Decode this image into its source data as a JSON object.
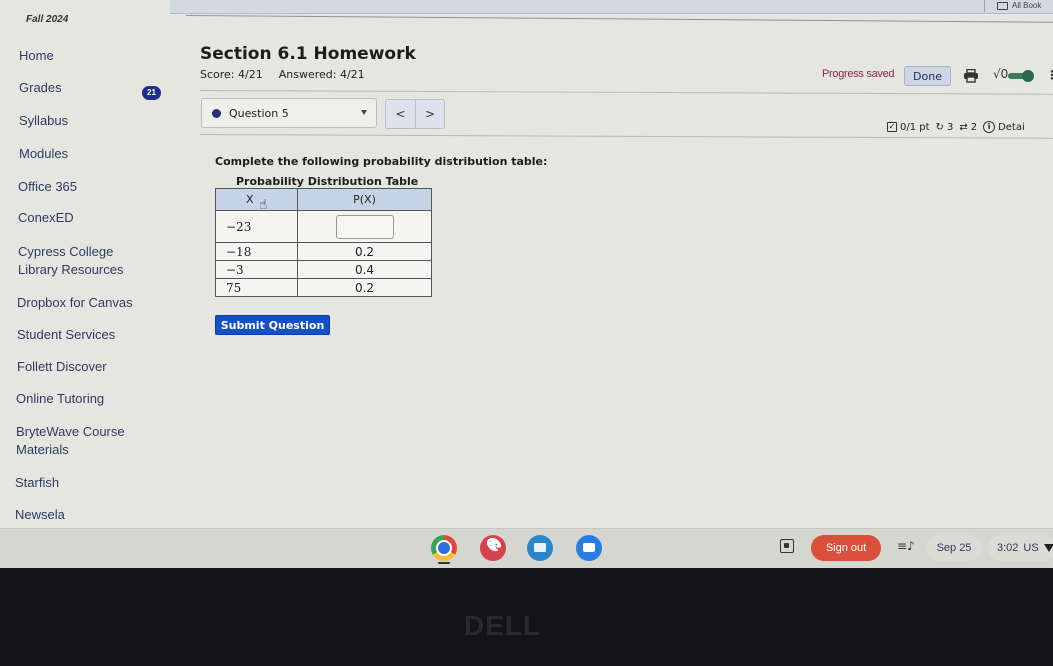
{
  "browser": {
    "bookmarks_label": "All Book"
  },
  "sidebar": {
    "term": "Fall 2024",
    "grades_badge": "21",
    "items": [
      {
        "label": "Home"
      },
      {
        "label": "Grades"
      },
      {
        "label": "Syllabus"
      },
      {
        "label": "Modules"
      },
      {
        "label": "Office 365"
      },
      {
        "label": "ConexED"
      },
      {
        "label": "Cypress College",
        "label2": "Library Resources"
      },
      {
        "label": "Dropbox for Canvas"
      },
      {
        "label": "Student Services"
      },
      {
        "label": "Follett Discover"
      },
      {
        "label": "Online Tutoring"
      },
      {
        "label": "BryteWave Course",
        "label2": "Materials"
      },
      {
        "label": "Starfish"
      },
      {
        "label": "Newsela"
      }
    ]
  },
  "assignment": {
    "title": "Section 6.1 Homework",
    "score": "Score: 4/21",
    "answered": "Answered: 4/21",
    "progress_status": "Progress saved",
    "done_label": "Done",
    "sqrt_label": "√0",
    "question_selector": "Question 5",
    "prev_label": "<",
    "next_label": ">",
    "points": "0/1 pt",
    "retries": "3",
    "attempts": "2",
    "details_label": "Detai"
  },
  "question": {
    "prompt": "Complete the following probability distribution table:",
    "table_caption": "Probability Distribution Table",
    "headers": [
      "X",
      "P(X)"
    ],
    "rows": [
      {
        "x": "−23",
        "p": ""
      },
      {
        "x": "−18",
        "p": "0.2"
      },
      {
        "x": "−3",
        "p": "0.4"
      },
      {
        "x": "75",
        "p": "0.2"
      }
    ],
    "answer_value": "",
    "submit_label": "Submit Question"
  },
  "shelf": {
    "apps": [
      "Chrome",
      "Canvas",
      "Classroom",
      "Meet"
    ],
    "sign_out_label": "Sign out",
    "date": "Sep 25",
    "time": "3:02",
    "locale": "US"
  },
  "device": {
    "brand": "DELL"
  }
}
